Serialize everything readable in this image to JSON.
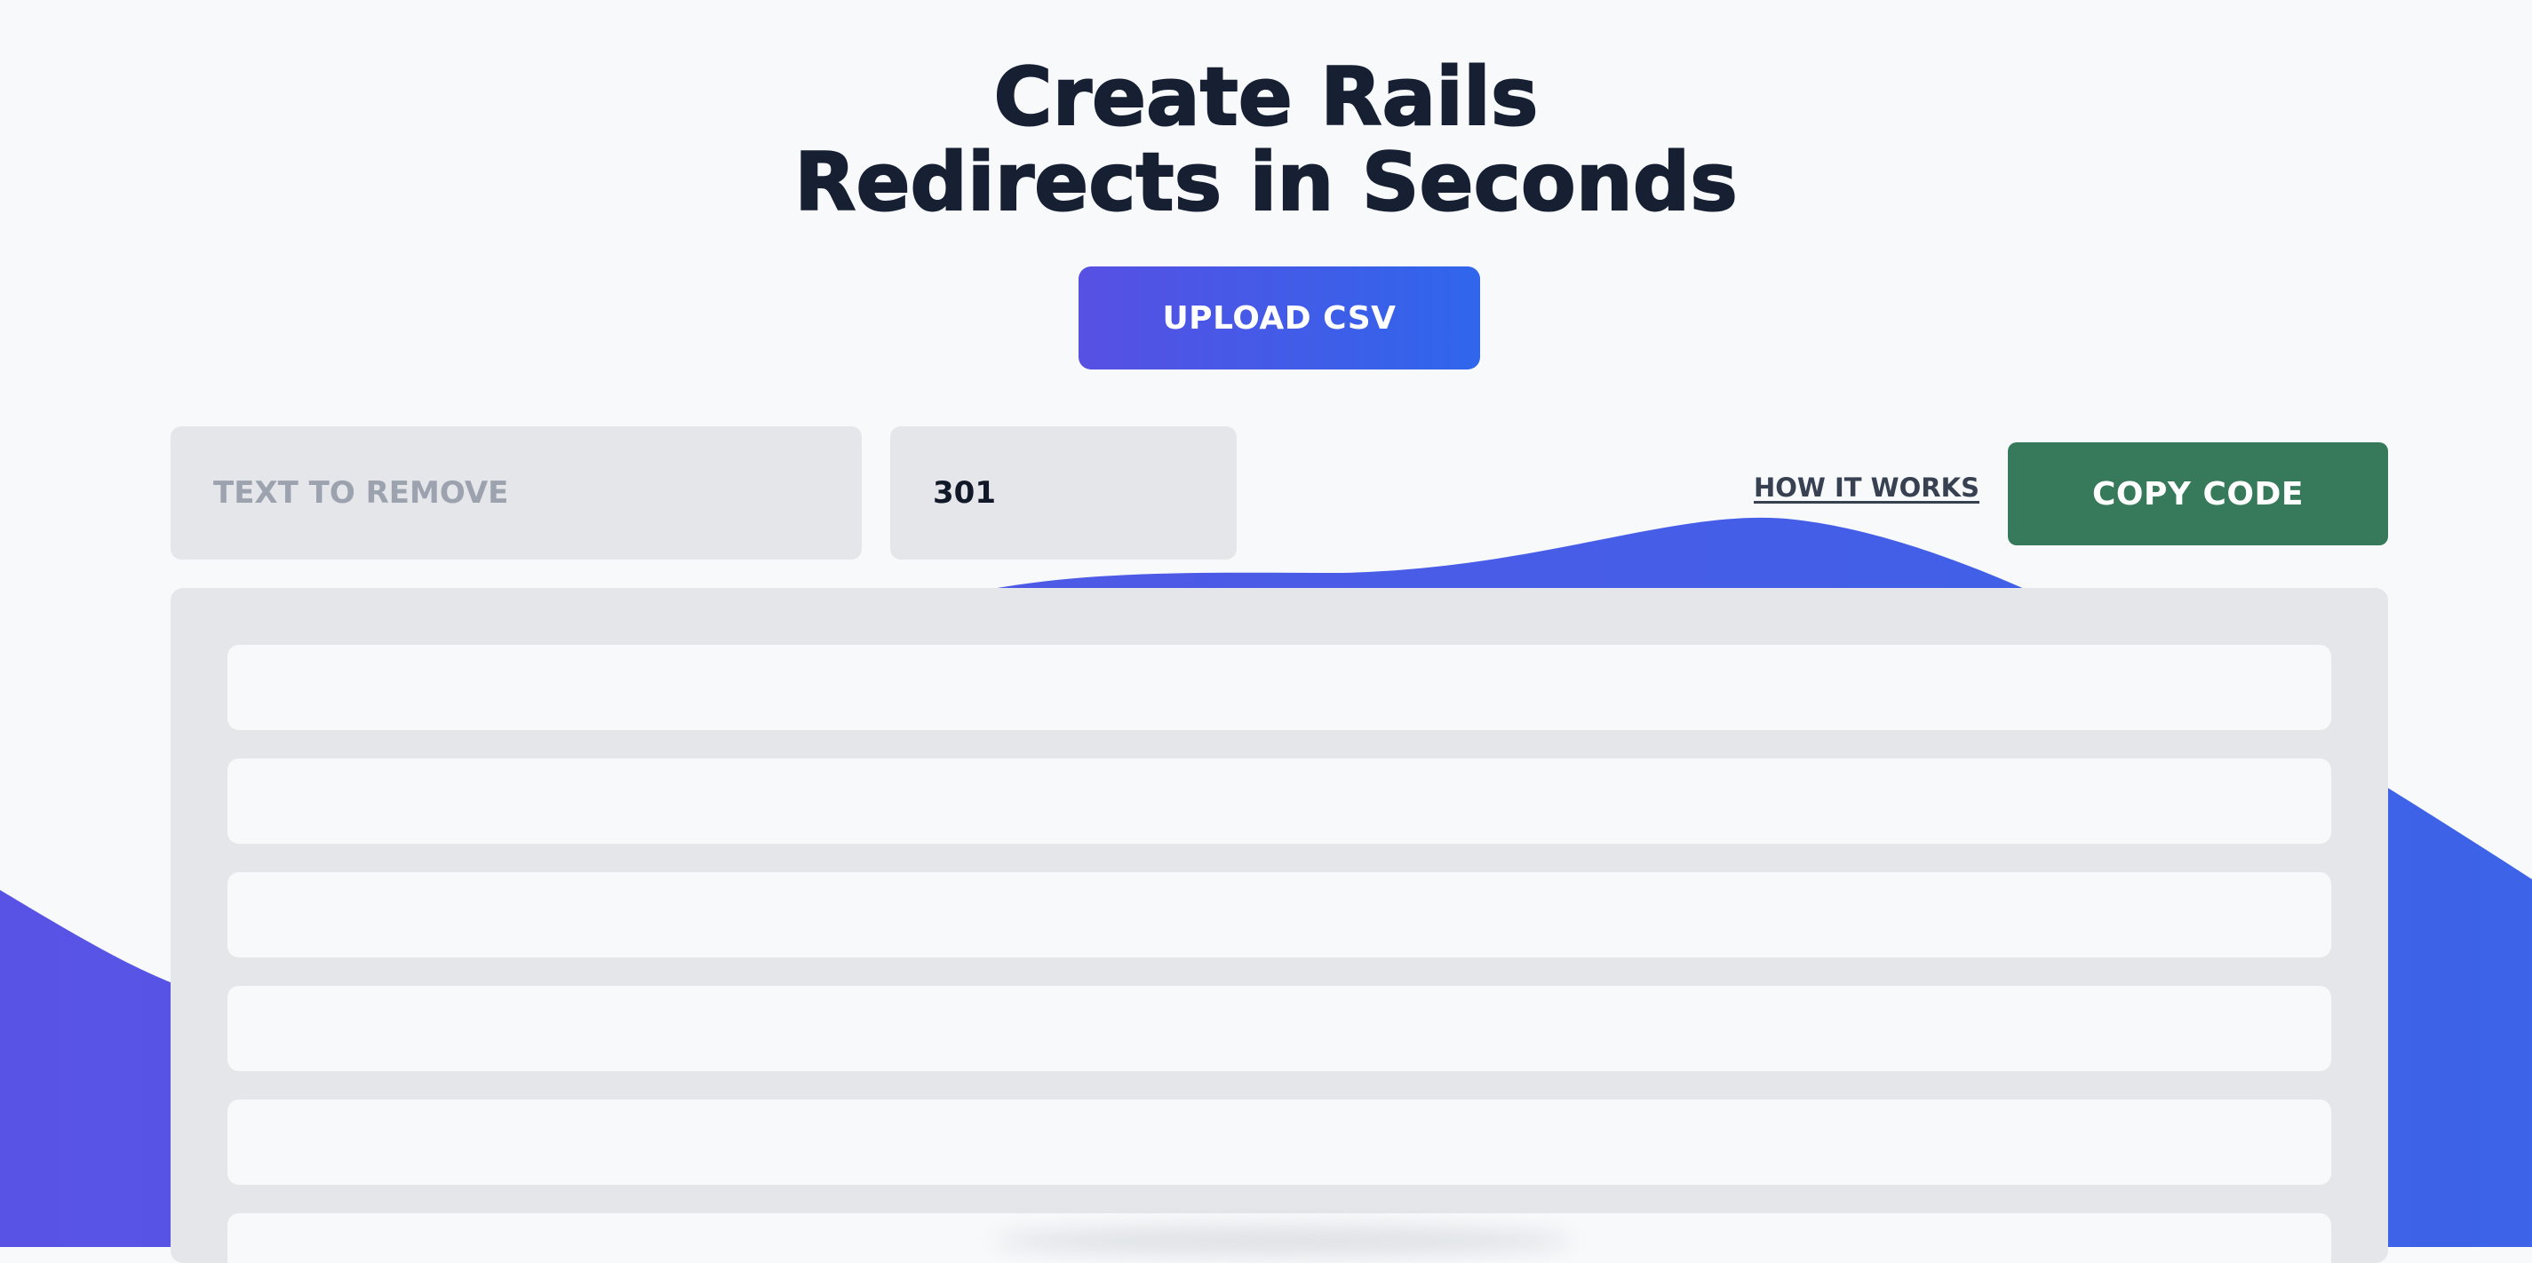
{
  "hero": {
    "line1": "Create Rails",
    "line2": "Redirects in Seconds"
  },
  "actions": {
    "upload_label": "UPLOAD CSV",
    "how_label": "HOW IT WORKS",
    "copy_label": "COPY CODE"
  },
  "inputs": {
    "text_to_remove": {
      "value": "",
      "placeholder": "TEXT TO REMOVE"
    },
    "status_code": {
      "value": "301",
      "placeholder": ""
    }
  },
  "redirect_rows": {
    "visible_count": 6,
    "row_values": [
      "",
      "",
      "",
      "",
      "",
      ""
    ]
  },
  "colors": {
    "background": "#f7f9fb",
    "headline": "#172033",
    "upload_gradient_start": "#5750e3",
    "upload_gradient_end": "#2f66ec",
    "copy_button": "#367a5b",
    "panel": "#e5e6ea",
    "wave_start": "#5953e5",
    "wave_end": "#3c63e8"
  }
}
